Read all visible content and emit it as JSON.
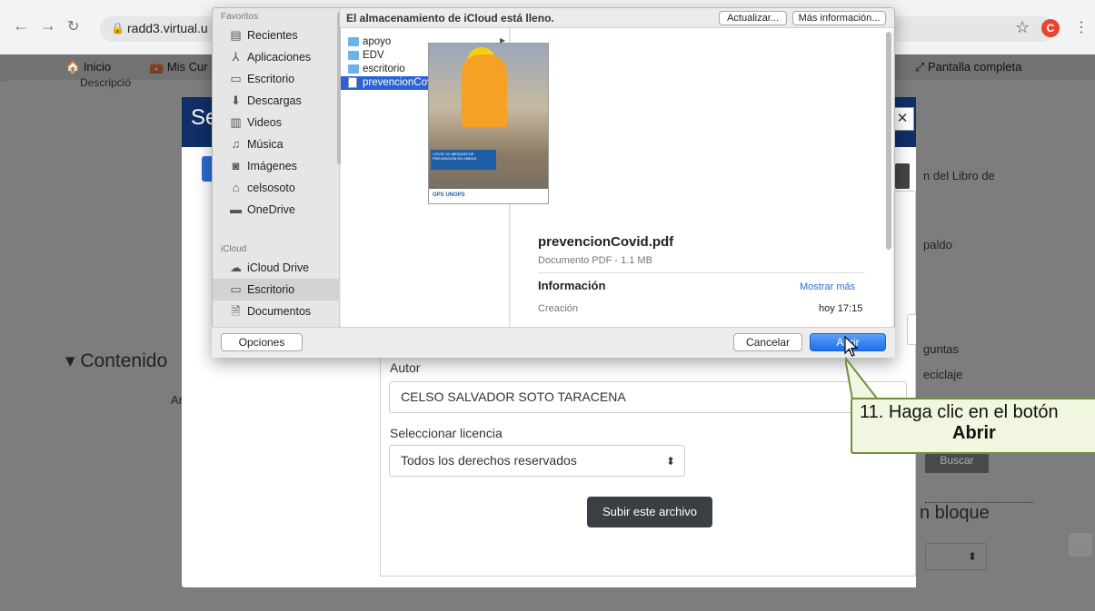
{
  "browser": {
    "url": "radd3.virtual.u",
    "profile_initial": "C"
  },
  "moodle": {
    "nav": {
      "home": "Inicio",
      "courses": "Mis Cur",
      "fullscreen": "Pantalla completa"
    },
    "bg": {
      "description_partial": "Descripció",
      "contenido": "Contenido",
      "contenido_sub": "Ar",
      "right1": "n del Libro de",
      "right2": "paldo",
      "right3": "guntas",
      "right4": "eciclaje",
      "bloque": "n bloque",
      "buscar": "Buscar"
    },
    "modal": {
      "title_partial": "Se",
      "author_label": "Autor",
      "author_value": "CELSO SALVADOR SOTO TARACENA",
      "license_label": "Seleccionar licencia",
      "license_value": "Todos los derechos reservados",
      "upload_button": "Subir este archivo"
    }
  },
  "dialog": {
    "sidebar": {
      "favorites_header": "Favoritos",
      "favorites": [
        {
          "label": "Recientes",
          "icon": "clock-icon"
        },
        {
          "label": "Aplicaciones",
          "icon": "applications-icon"
        },
        {
          "label": "Escritorio",
          "icon": "desktop-icon"
        },
        {
          "label": "Descargas",
          "icon": "download-icon"
        },
        {
          "label": "Videos",
          "icon": "film-icon"
        },
        {
          "label": "Música",
          "icon": "music-icon"
        },
        {
          "label": "Imágenes",
          "icon": "camera-icon"
        },
        {
          "label": "celsosoto",
          "icon": "home-icon"
        },
        {
          "label": "OneDrive",
          "icon": "folder-icon"
        }
      ],
      "icloud_header": "iCloud",
      "icloud": [
        {
          "label": "iCloud Drive",
          "icon": "cloud-icon"
        },
        {
          "label": "Escritorio",
          "icon": "desktop-icon"
        },
        {
          "label": "Documentos",
          "icon": "document-icon"
        }
      ]
    },
    "banner": {
      "message": "El almacenamiento de iCloud está lleno.",
      "update_button": "Actualizar...",
      "more_button": "Más información..."
    },
    "files": [
      {
        "name": "apoyo",
        "type": "folder"
      },
      {
        "name": "EDV",
        "type": "folder"
      },
      {
        "name": "escritorio",
        "type": "folder"
      },
      {
        "name": "prevencionCovid.pdf",
        "type": "pdf",
        "selected": true
      }
    ],
    "preview": {
      "filename": "prevencionCovid.pdf",
      "kind": "Documento PDF - 1.1 MB",
      "info_heading": "Información",
      "show_more": "Mostrar más",
      "created_label": "Creación",
      "created_value": "hoy 17:15",
      "thumb_caption": "COVID-19: MEDIDAS DE PREVENCIÓN EN OBRAS",
      "thumb_footer": "OPS  UNOPS"
    },
    "buttons": {
      "options": "Opciones",
      "cancel": "Cancelar",
      "open": "Abrir"
    }
  },
  "callout": {
    "line1": "11. Haga clic en el botón",
    "line2": "Abrir"
  },
  "colors": {
    "accent_blue": "#2a63d6",
    "modal_header": "#0f2f66",
    "callout_bg": "#f0f6df",
    "callout_border": "#6f8f3c"
  }
}
